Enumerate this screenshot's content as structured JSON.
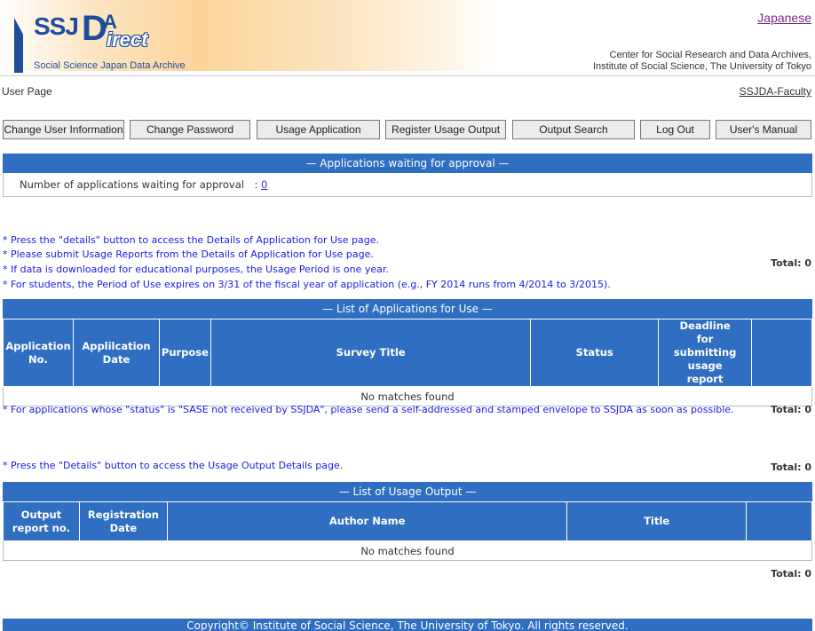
{
  "header": {
    "logo_ssj": "SSJ",
    "logo_d": "D",
    "logo_a": "A",
    "logo_irect": "irect",
    "logo_subtitle": "Social Science Japan Data Archive",
    "language_link": "Japanese",
    "org_line1": "Center for Social Research and Data Archives,",
    "org_line2": "Institute of Social Science, The University of Tokyo"
  },
  "page": {
    "title": "User Page",
    "faculty_link": "SSJDA-Faculty"
  },
  "nav": {
    "change_user_info": "Change User Information",
    "change_password": "Change Password",
    "usage_application": "Usage Application",
    "register_usage_output": "Register Usage Output",
    "output_search": "Output Search",
    "log_out": "Log Out",
    "users_manual": "User's Manual"
  },
  "waiting": {
    "header": "—  Applications waiting for approval  —",
    "label": "Number of applications waiting for approval　:",
    "count": "0"
  },
  "applications": {
    "notes": [
      "* Press the \"details\" button to access the Details of Application for Use page.",
      "* Please submit Usage Reports from the Details of Application for Use page.",
      "* If data is downloaded for educational purposes, the Usage Period is one year.",
      "* For students, the Period of Use expires on 3/31 of the fiscal year of application (e.g., FY 2014 runs from 4/2014 to 3/2015)."
    ],
    "total_top": "Total: 0",
    "header": "—  List of Applications for Use  —",
    "columns": [
      "Application No.",
      "Applilcation Date",
      "Purpose",
      "Survey Title",
      "Status",
      "Deadline for submitting usage report",
      ""
    ],
    "empty": "No matches found",
    "bottom_note": "* For applications whose \"status\" is \"SASE not received by SSJDA\", please send a self-addressed and stamped envelope to SSJDA as soon as possible.",
    "total_bottom": "Total: 0"
  },
  "outputs": {
    "note": "* Press the \"Details\" button to access the Usage Output Details page.",
    "total_top": "Total: 0",
    "header": "—  List of Usage Output  —",
    "columns": [
      "Output report no.",
      "Registration Date",
      "Author Name",
      "Title",
      ""
    ],
    "empty": "No matches found",
    "total_bottom": "Total: 0"
  },
  "footer": {
    "copyright": "Copyright© Institute of Social Science, The University of Tokyo. All rights reserved."
  }
}
